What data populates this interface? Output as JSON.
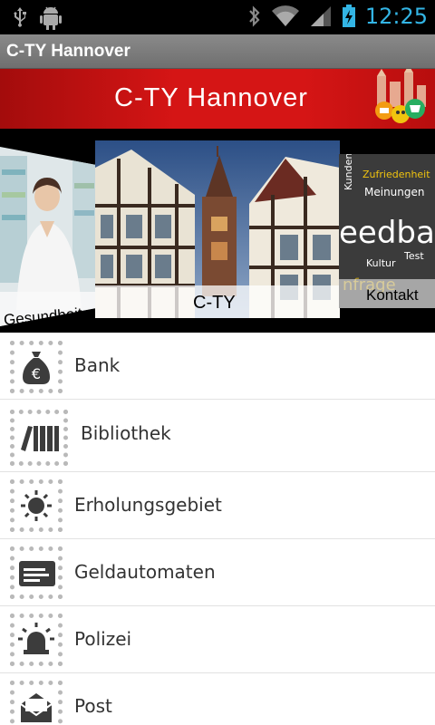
{
  "status_bar": {
    "time": "12:25",
    "icons": [
      "usb-icon",
      "android-debug-icon",
      "bluetooth-icon",
      "wifi-icon",
      "signal-icon",
      "battery-charging-icon"
    ]
  },
  "action_bar": {
    "title": "C-TY Hannover"
  },
  "banner": {
    "logo_text": "C-TY Hannover"
  },
  "carousel": {
    "cards": [
      {
        "caption": "Gesundheit"
      },
      {
        "caption": "C-TY"
      },
      {
        "caption": "Kontakt"
      }
    ]
  },
  "menu": {
    "items": [
      {
        "label": "Bank",
        "icon": "money-bag-icon"
      },
      {
        "label": "Bibliothek",
        "icon": "books-icon"
      },
      {
        "label": "Erholungsgebiet",
        "icon": "sun-icon"
      },
      {
        "label": "Geldautomaten",
        "icon": "atm-card-icon"
      },
      {
        "label": "Polizei",
        "icon": "police-siren-icon"
      },
      {
        "label": "Post",
        "icon": "mail-icon"
      }
    ]
  },
  "colors": {
    "accent": "#33b5e5",
    "banner_red": "#d51515",
    "icon_dark": "#3c3c3c"
  }
}
